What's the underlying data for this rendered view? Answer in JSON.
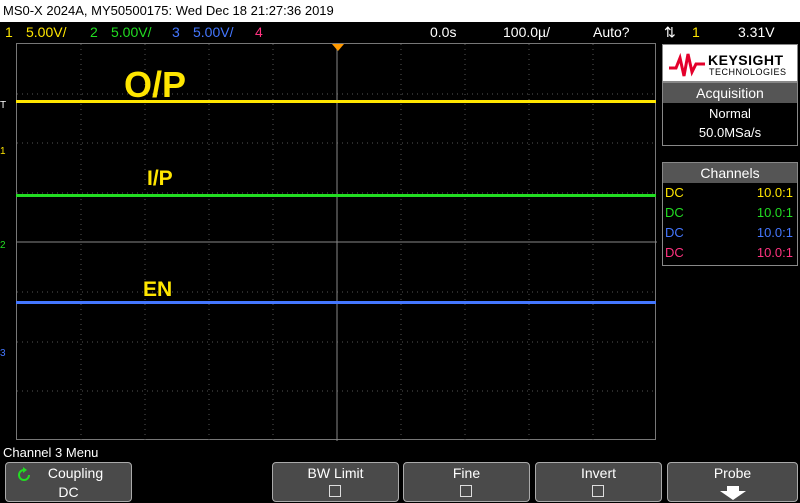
{
  "title_bar": "MS0-X 2024A, MY50500175: Wed Dec 18 21:27:36 2019",
  "channel_bar": {
    "ch1_num": "1",
    "ch1_scale": "5.00V/",
    "ch2_num": "2",
    "ch2_scale": "5.00V/",
    "ch3_num": "3",
    "ch3_scale": "5.00V/",
    "ch4_num": "4",
    "time_offset": "0.0s",
    "time_scale": "100.0µ/",
    "trigger_mode": "Auto?",
    "trig_channel": "1",
    "trig_level": "3.31V"
  },
  "colors": {
    "ch1": "#ffe600",
    "ch2": "#22dd22",
    "ch3": "#4477ff",
    "ch4": "#ff3380"
  },
  "traces": {
    "op_label": "O/P",
    "ip_label": "I/P",
    "en_label": "EN"
  },
  "markers": {
    "trigger": "T",
    "ch1": "1",
    "ch2": "2",
    "ch3": "3"
  },
  "logo": {
    "brand": "KEYSIGHT",
    "sub": "TECHNOLOGIES"
  },
  "acquisition": {
    "header": "Acquisition",
    "mode": "Normal",
    "rate": "50.0MSa/s"
  },
  "channels": {
    "header": "Channels",
    "rows": [
      {
        "coupling": "DC",
        "probe": "10.0:1"
      },
      {
        "coupling": "DC",
        "probe": "10.0:1"
      },
      {
        "coupling": "DC",
        "probe": "10.0:1"
      },
      {
        "coupling": "DC",
        "probe": "10.0:1"
      }
    ]
  },
  "menu": {
    "title": "Channel 3 Menu"
  },
  "softkeys": {
    "coupling_label": "Coupling",
    "coupling_value": "DC",
    "bw_limit_label": "BW Limit",
    "fine_label": "Fine",
    "invert_label": "Invert",
    "probe_label": "Probe"
  }
}
